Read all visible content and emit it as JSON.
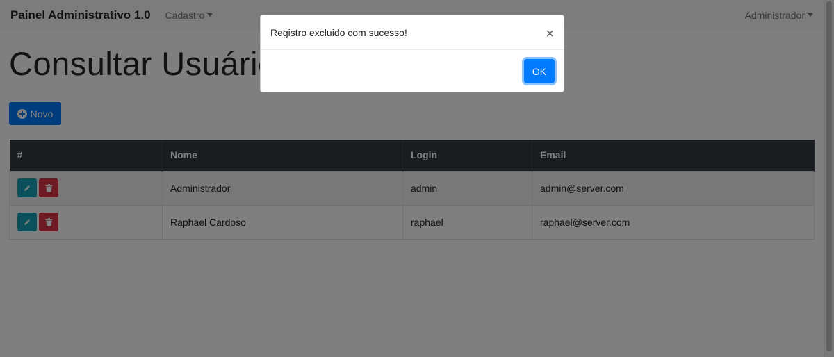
{
  "navbar": {
    "brand": "Painel Administrativo 1.0",
    "menu_cadastro": "Cadastro",
    "menu_user": "Administrador"
  },
  "page": {
    "title": "Consultar Usuários",
    "new_button": "Novo"
  },
  "table": {
    "headers": [
      "#",
      "Nome",
      "Login",
      "Email"
    ],
    "rows": [
      {
        "nome": "Administrador",
        "login": "admin",
        "email": "admin@server.com"
      },
      {
        "nome": "Raphael Cardoso",
        "login": "raphael",
        "email": "raphael@server.com"
      }
    ]
  },
  "modal": {
    "message": "Registro excluido com sucesso!",
    "close": "×",
    "ok_label": "OK"
  },
  "icons": {
    "new": "plus-circle-icon",
    "edit": "pencil-icon",
    "delete": "trash-icon",
    "close": "close-icon",
    "dropdown": "caret-down-icon"
  },
  "colors": {
    "primary": "#007bff",
    "info": "#17a2b8",
    "danger": "#dc3545",
    "table_header": "#343a40"
  }
}
